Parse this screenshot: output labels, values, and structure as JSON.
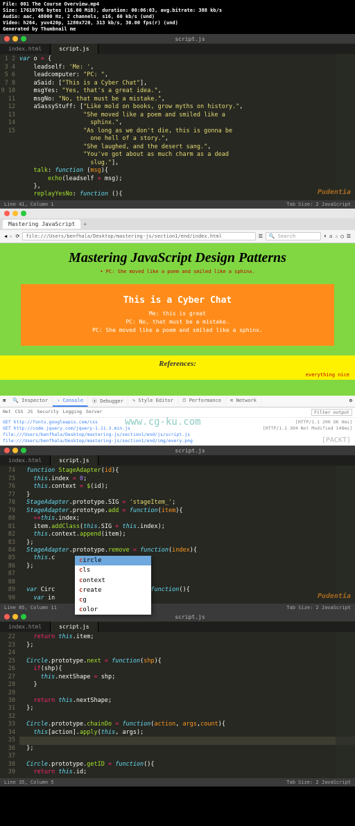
{
  "header": {
    "l1": "File: 001 The Course Overview.mp4",
    "l2": "Size: 17610706 bytes (16.00 MiB), duration: 00:06:03, avg.bitrate: 388 kb/s",
    "l3": "Audio: aac, 48000 Hz, 2 channels, s16, 60 kb/s (und)",
    "l4": "Video: h264, yuv420p, 1280x720, 313 kb/s, 30.00 fps(r) (und)",
    "l5": "Generated by Thumbnail me"
  },
  "editor1": {
    "window_title": "script.js",
    "tabs": [
      "index.html",
      "script.js"
    ],
    "gutter": [
      "1",
      "2",
      "3",
      "4",
      "5",
      "6",
      "7",
      "8",
      "9",
      "10",
      "11",
      "12",
      "13",
      "14",
      "15"
    ],
    "status_left": "Line 41, Column 1",
    "status_right": "Tab Size: 2    JavaScript",
    "brand": "Pudentia"
  },
  "browser": {
    "tab_title": "Mastering JavaScript",
    "url": "file:///Users/benfhala/Desktop/mastering-js/section1/end/index.html",
    "search_placeholder": "Search",
    "page_title": "Mastering JavaScript Design Patterns",
    "subtitle": "• PC: She moved like a poem and smiled like a sphinx.",
    "chat_title": "This is a Cyber Chat",
    "chat_lines": [
      "Me: this is great",
      "PC: No, that must be a mistake.",
      "PC: She moved like a poem and smiled like a sphinx."
    ],
    "refs": "References:",
    "nice": "everything nice",
    "watermark": "www.cg-ku.com",
    "packt": "PACKT"
  },
  "devtools": {
    "tabs": [
      "Inspector",
      "Console",
      "Debugger",
      "Style Editor",
      "Performance",
      "Network"
    ],
    "subtabs": [
      "Net",
      "CSS",
      "JS",
      "Security",
      "Logging",
      "Server"
    ],
    "filter": "Filter output",
    "lines": [
      {
        "left": "GET http://fonts.googleapis.com/css",
        "right": "[HTTP/1.1 200 OK 0ms]"
      },
      {
        "left": "GET http://code.jquery.com/jquery-1.11.3.min.js",
        "right": "[HTTP/1.1 304 Not Modified 148ms]"
      },
      {
        "left": "file:///Users/benfhala/Desktop/mastering-js/section1/end/js/script.js",
        "right": ""
      },
      {
        "left": "file:///Users/benfhala/Desktop/mastering-js/section1/end/img/every.png",
        "right": ""
      }
    ]
  },
  "editor2": {
    "window_title": "script.js",
    "tabs": [
      "index.html",
      "script.js"
    ],
    "gutter": [
      "74",
      "75",
      "76",
      "77",
      "78",
      "79",
      "80",
      "81",
      "82",
      "83",
      "84",
      "85",
      "86",
      "87",
      "88",
      "89",
      "90"
    ],
    "autocomplete": [
      "circle",
      "cls",
      "context",
      "create",
      "cg",
      "color"
    ],
    "status_left": "Line 85, Column 11",
    "status_right": "Tab Size: 2    JavaScript"
  },
  "editor3": {
    "window_title": "script.js",
    "tabs": [
      "index.html",
      "script.js"
    ],
    "gutter": [
      "22",
      "23",
      "24",
      "25",
      "26",
      "27",
      "28",
      "29",
      "30",
      "31",
      "32",
      "33",
      "34",
      "35",
      "36",
      "37",
      "38",
      "39"
    ],
    "status_left": "Line 35, Column 5",
    "status_right": "Tab Size: 2    JavaScript"
  }
}
